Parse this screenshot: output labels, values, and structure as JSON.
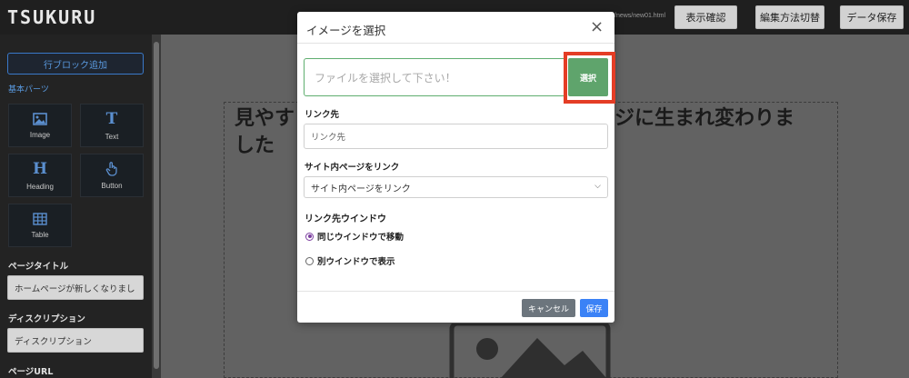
{
  "app": {
    "logo": "TSUKURU",
    "url": "/news/new01.html",
    "buttons": {
      "preview": "表示確認",
      "switch_edit": "編集方法切替",
      "save_data": "データ保存"
    }
  },
  "sidebar": {
    "add_row": "行ブロック追加",
    "basic_parts": "基本パーツ",
    "parts": [
      {
        "label": "Image",
        "icon": "image-icon"
      },
      {
        "label": "Text",
        "icon": "text-icon"
      },
      {
        "label": "Heading",
        "icon": "heading-icon"
      },
      {
        "label": "Button",
        "icon": "pointer-hand-icon"
      },
      {
        "label": "Table",
        "icon": "table-icon"
      }
    ],
    "page_title_label": "ページタイトル",
    "page_title_value": "ホームページが新しくなりまし",
    "description_label": "ディスクリプション",
    "description_placeholder": "ディスクリプション",
    "page_url_label": "ページURL"
  },
  "canvas": {
    "headline_left": "見やす",
    "headline_right": "ジに生まれ変わりま",
    "headline_line2": "した"
  },
  "modal": {
    "title": "イメージを選択",
    "close": "×",
    "file_placeholder": "ファイルを選択して下さい！",
    "select_button": "選択",
    "link_label": "リンク先",
    "link_placeholder": "リンク先",
    "internal_label": "サイト内ページをリンク",
    "internal_selected": "サイト内ページをリンク",
    "window_label": "リンク先ウインドウ",
    "options": [
      {
        "label": "同じウインドウで移動",
        "selected": true
      },
      {
        "label": "別ウインドウで表示",
        "selected": false
      }
    ],
    "cancel": "キャンセル",
    "save": "保存"
  },
  "colors": {
    "highlight": "#e43d25",
    "select_button": "#5fa46c",
    "save_button": "#3b82f6",
    "cancel_button": "#6c757d"
  }
}
